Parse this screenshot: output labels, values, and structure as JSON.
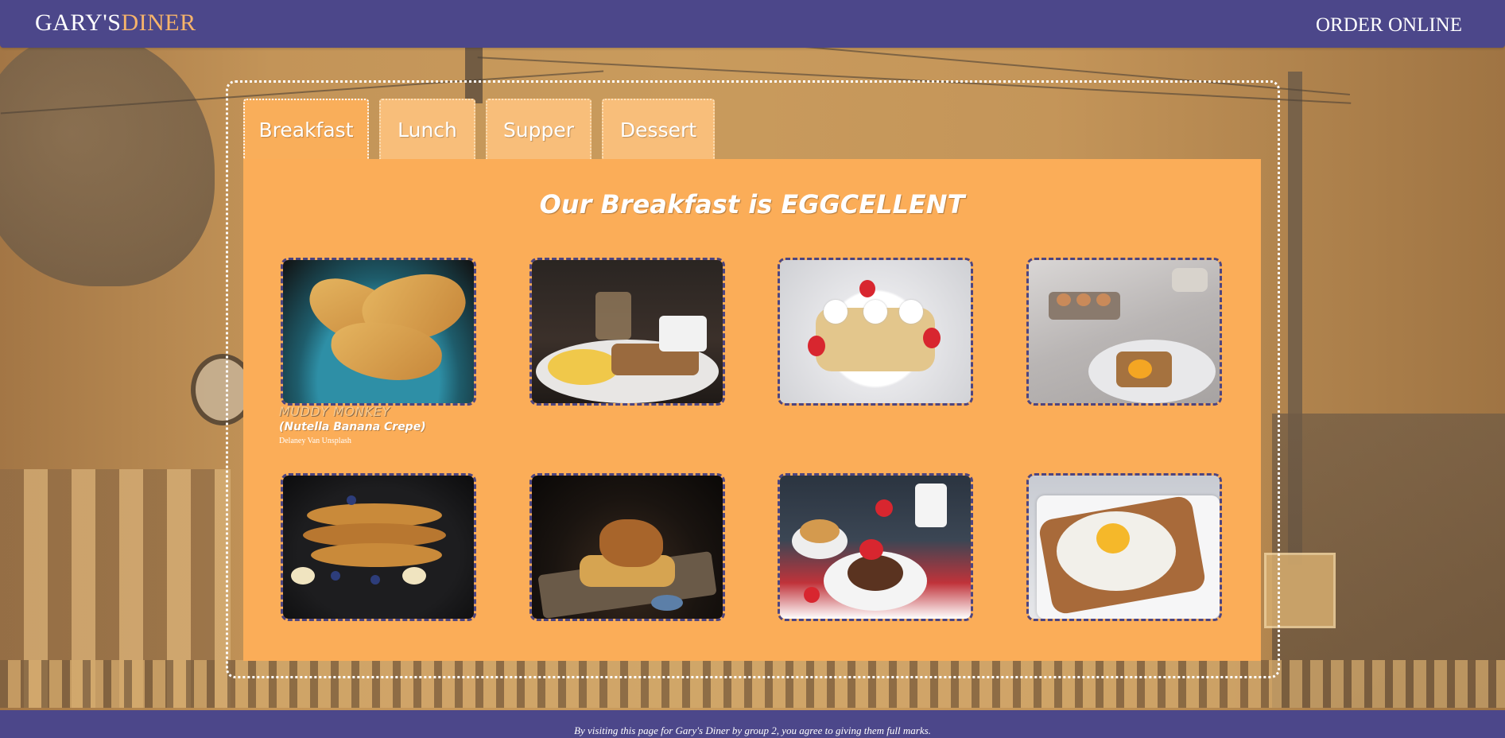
{
  "header": {
    "logo_part1": "GARY'S",
    "logo_part2": "DINER",
    "order_link": "ORDER ONLINE"
  },
  "tabs": [
    {
      "label": "Breakfast",
      "active": true
    },
    {
      "label": "Lunch",
      "active": false
    },
    {
      "label": "Supper",
      "active": false
    },
    {
      "label": "Dessert",
      "active": false
    }
  ],
  "panel": {
    "title": "Our Breakfast is EGGCELLENT",
    "items": [
      {
        "name": "MUDDY MONKEY",
        "subtitle": "(Nutella Banana Crepe)",
        "credit": "Delaney Van Unsplash"
      }
    ]
  },
  "footer": {
    "text": "By visiting this page for Gary's Diner by group 2, you agree to giving them full marks."
  },
  "colors": {
    "header_bg": "#4c478a",
    "logo_accent": "#f7b46a",
    "panel_bg": "#fbad58",
    "tab_bg": "#f8be7a",
    "card_border": "#4d4580"
  }
}
